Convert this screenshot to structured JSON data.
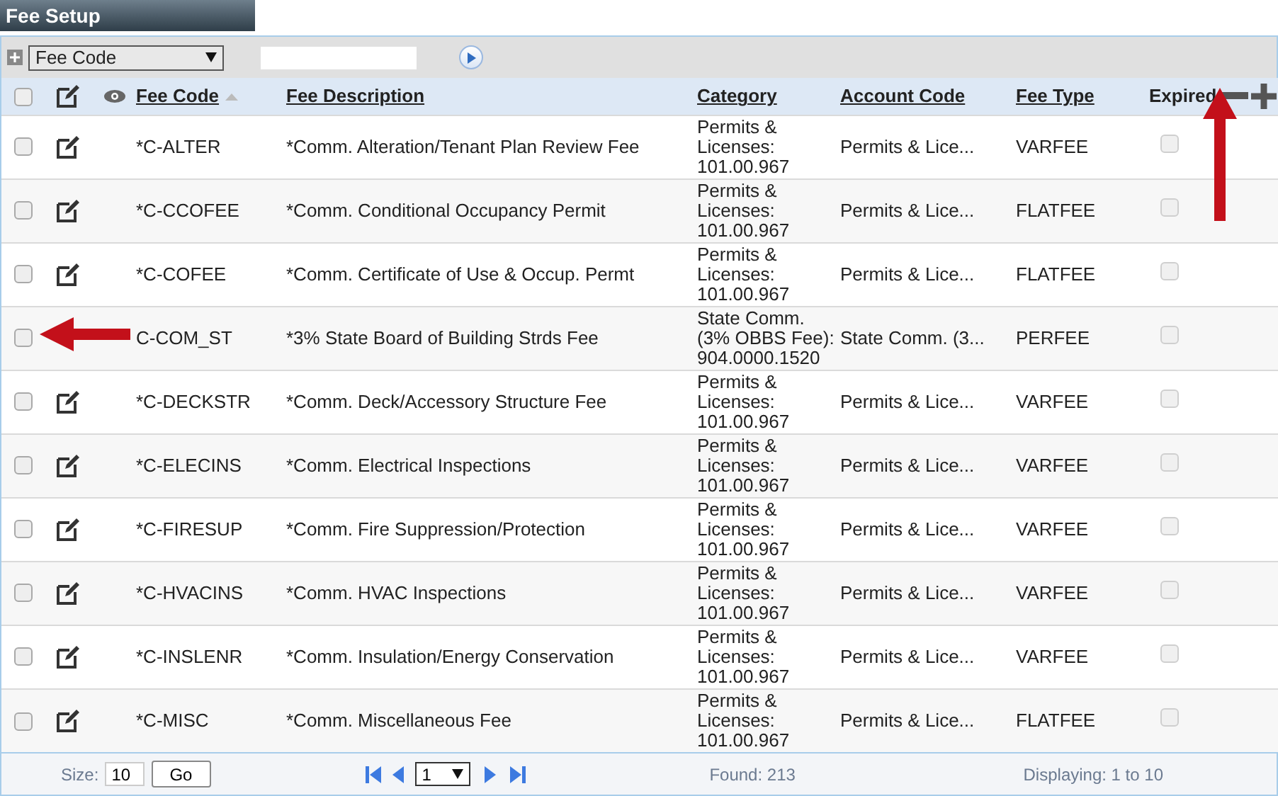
{
  "title": "Fee Setup",
  "toolbar": {
    "filter_field": "Fee Code"
  },
  "select_all_checked": false,
  "columns": [
    {
      "label": "Fee Code",
      "sorted": true
    },
    {
      "label": "Fee Description",
      "sorted": false
    },
    {
      "label": "Category",
      "sorted": false
    },
    {
      "label": "Account Code",
      "sorted": false
    },
    {
      "label": "Fee Type",
      "sorted": false
    },
    {
      "label": "Expired",
      "sorted": false
    }
  ],
  "rows": [
    {
      "code": "*C-ALTER",
      "description": "*Comm. Alteration/Tenant Plan Review Fee",
      "category": "Permits & Licenses: 101.00.967",
      "account_code": "Permits & Lice...",
      "fee_type": "VARFEE",
      "checked": false,
      "expired": false
    },
    {
      "code": "*C-CCOFEE",
      "description": "*Comm. Conditional Occupancy Permit",
      "category": "Permits & Licenses: 101.00.967",
      "account_code": "Permits & Lice...",
      "fee_type": "FLATFEE",
      "checked": false,
      "expired": false
    },
    {
      "code": "*C-COFEE",
      "description": "*Comm. Certificate of Use & Occup. Permt",
      "category": "Permits & Licenses: 101.00.967",
      "account_code": "Permits & Lice...",
      "fee_type": "FLATFEE",
      "checked": false,
      "expired": false
    },
    {
      "code": "C-COM_ST",
      "description": "*3% State Board of Building Strds Fee",
      "category": "State Comm. (3% OBBS Fee): 904.0000.1520",
      "account_code": "State Comm. (3...",
      "fee_type": "PERFEE",
      "checked": false,
      "expired": false,
      "edit_icon": false
    },
    {
      "code": "*C-DECKSTR",
      "description": "*Comm. Deck/Accessory Structure Fee",
      "category": "Permits & Licenses: 101.00.967",
      "account_code": "Permits & Lice...",
      "fee_type": "VARFEE",
      "checked": false,
      "expired": false
    },
    {
      "code": "*C-ELECINS",
      "description": "*Comm. Electrical Inspections",
      "category": "Permits & Licenses: 101.00.967",
      "account_code": "Permits & Lice...",
      "fee_type": "VARFEE",
      "checked": false,
      "expired": false
    },
    {
      "code": "*C-FIRESUP",
      "description": "*Comm. Fire Suppression/Protection",
      "category": "Permits & Licenses: 101.00.967",
      "account_code": "Permits & Lice...",
      "fee_type": "VARFEE",
      "checked": false,
      "expired": false
    },
    {
      "code": "*C-HVACINS",
      "description": "*Comm. HVAC Inspections",
      "category": "Permits & Licenses: 101.00.967",
      "account_code": "Permits & Lice...",
      "fee_type": "VARFEE",
      "checked": false,
      "expired": false
    },
    {
      "code": "*C-INSLENR",
      "description": "*Comm. Insulation/Energy Conservation",
      "category": "Permits & Licenses: 101.00.967",
      "account_code": "Permits & Lice...",
      "fee_type": "VARFEE",
      "checked": false,
      "expired": false
    },
    {
      "code": "*C-MISC",
      "description": "*Comm. Miscellaneous Fee",
      "category": "Permits & Licenses: 101.00.967",
      "account_code": "Permits & Lice...",
      "fee_type": "FLATFEE",
      "checked": false,
      "expired": false
    }
  ],
  "footer": {
    "size_label": "Size:",
    "size_value": "10",
    "go": "Go",
    "page": "1",
    "found": "Found: 213",
    "displaying": "Displaying: 1 to 10"
  }
}
